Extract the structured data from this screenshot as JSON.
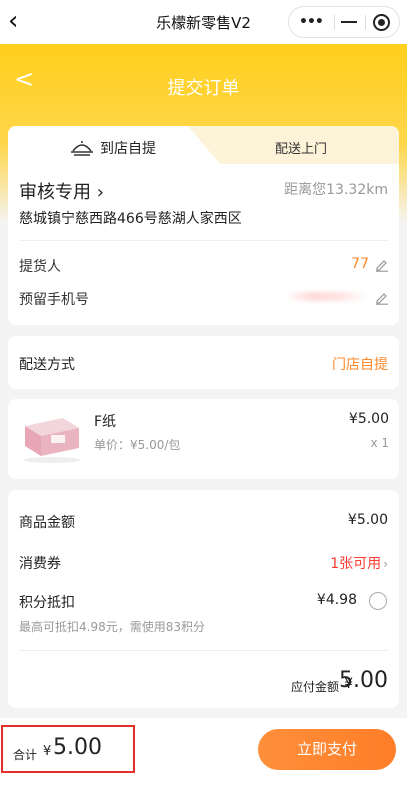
{
  "app": {
    "title": "乐檬新零售V2"
  },
  "page": {
    "title": "提交订单"
  },
  "tabs": {
    "pickup": "到店自提",
    "delivery": "配送上门"
  },
  "store": {
    "name": "审核专用",
    "distance": "距离您13.32km",
    "address": "慈城镇宁慈西路466号慈湖人家西区"
  },
  "pickup_person": {
    "label": "提货人",
    "value": "77"
  },
  "phone": {
    "label": "预留手机号"
  },
  "delivery_method": {
    "label": "配送方式",
    "value": "门店自提"
  },
  "product": {
    "name": "F纸",
    "price": "¥5.00",
    "unit_price": "单价：¥5.00/包",
    "quantity": "x 1"
  },
  "summary": {
    "goods_amount_label": "商品金额",
    "goods_amount": "¥5.00",
    "coupon_label": "消费券",
    "coupon_value": "1张可用",
    "points_label": "积分抵扣",
    "points_value": "¥4.98",
    "points_note": "最高可抵扣4.98元，需使用83积分",
    "payable_label": "应付金额",
    "payable_currency": "¥",
    "payable_amount": "5.00"
  },
  "bottom_bar": {
    "total_label": "合计",
    "currency": "¥",
    "total_amount": "5.00",
    "pay_button": "立即支付"
  },
  "colors": {
    "brand_yellow": "#ffcf1c",
    "accent_orange": "#ff8a2c",
    "coupon_red": "#ff3b30",
    "highlight_red": "#e0322b"
  }
}
